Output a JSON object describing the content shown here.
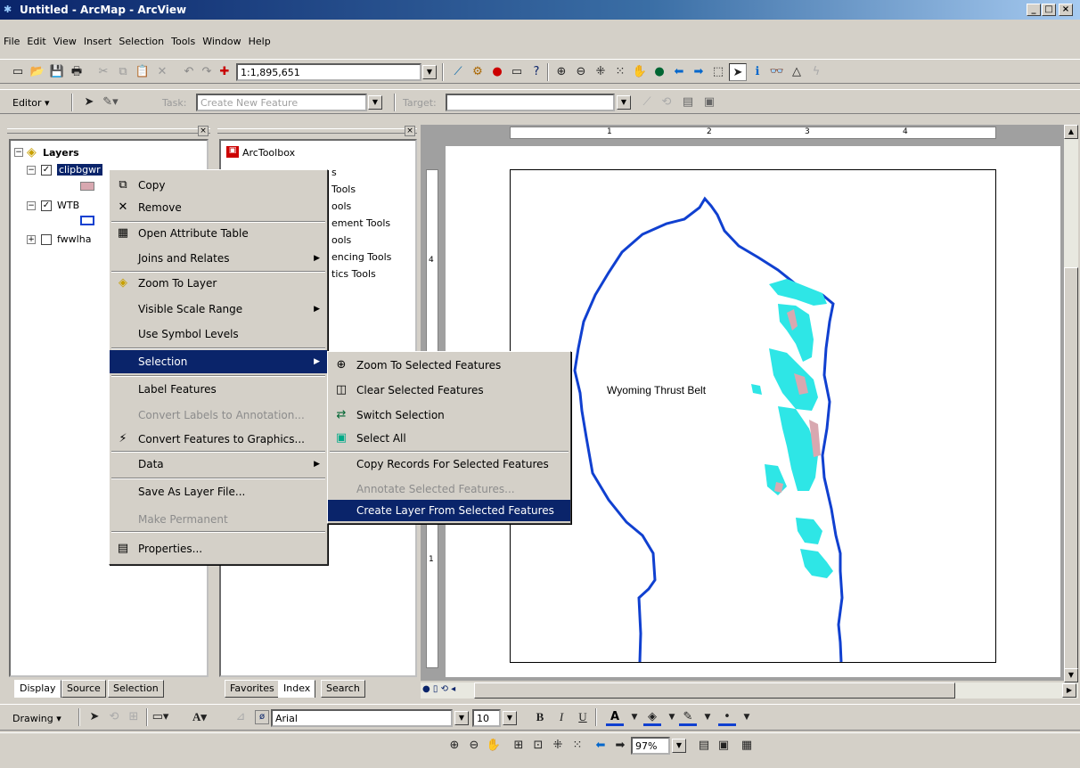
{
  "window": {
    "title": "Untitled - ArcMap - ArcView",
    "controls": [
      "_",
      "□",
      "×"
    ]
  },
  "menubar": {
    "items": [
      "File",
      "Edit",
      "View",
      "Insert",
      "Selection",
      "Tools",
      "Window",
      "Help"
    ]
  },
  "standard_toolbar": {
    "scale_value": "1:1,895,651"
  },
  "editor_toolbar": {
    "editor_label": "Editor ▾",
    "task_label": "Task:",
    "task_value": "Create New Feature",
    "target_label": "Target:",
    "target_value": ""
  },
  "toc": {
    "root_label": "Layers",
    "layers": [
      {
        "name": "clipbgwr",
        "checked": true,
        "expanded": true
      },
      {
        "name": "WTB",
        "checked": true,
        "expanded": true
      },
      {
        "name": "fwwlha",
        "checked": false,
        "expanded": false
      }
    ],
    "tabs": [
      "Display",
      "Source",
      "Selection"
    ]
  },
  "toolbox": {
    "root_label": "ArcToolbox",
    "items": [
      "Analysis Tools",
      "Cartography Tools",
      "Conversion Tools",
      "Data Management Tools",
      "Geocoding Tools",
      "Linear Referencing Tools",
      "Spatial Statistics Tools"
    ],
    "visible_fragments": [
      "s",
      "Tools",
      "ools",
      "ement Tools",
      "ools",
      "encing Tools",
      "tics Tools"
    ],
    "tabs": [
      "Favorites",
      "Index",
      "Search"
    ]
  },
  "context_menu": {
    "items": [
      {
        "label": "Copy",
        "icon": "copy-icon"
      },
      {
        "label": "Remove",
        "icon": "remove-icon"
      },
      {
        "label": "Open Attribute Table",
        "icon": "table-icon"
      },
      {
        "label": "Joins and Relates",
        "submenu": true
      },
      {
        "label": "Zoom To Layer",
        "icon": "zoom-layer-icon"
      },
      {
        "label": "Visible Scale Range",
        "submenu": true
      },
      {
        "label": "Use Symbol Levels"
      },
      {
        "label": "Selection",
        "submenu": true,
        "highlighted": true
      },
      {
        "label": "Label Features"
      },
      {
        "label": "Convert Labels to Annotation...",
        "disabled": true
      },
      {
        "label": "Convert Features to Graphics...",
        "icon": "convert-graphics-icon"
      },
      {
        "label": "Data",
        "submenu": true
      },
      {
        "label": "Save As Layer File..."
      },
      {
        "label": "Make Permanent",
        "disabled": true
      },
      {
        "label": "Properties...",
        "icon": "properties-icon"
      }
    ]
  },
  "selection_submenu": {
    "items": [
      {
        "label": "Zoom To Selected Features",
        "icon": "zoom-selected-icon"
      },
      {
        "label": "Clear Selected Features",
        "icon": "clear-selection-icon"
      },
      {
        "label": "Switch Selection",
        "icon": "switch-selection-icon"
      },
      {
        "label": "Select All",
        "icon": "select-all-icon"
      },
      {
        "label": "Copy Records For Selected Features"
      },
      {
        "label": "Annotate Selected Features...",
        "disabled": true
      },
      {
        "label": "Create Layer From Selected Features",
        "highlighted": true
      }
    ]
  },
  "map": {
    "label": "Wyoming Thrust Belt",
    "ruler_ticks": [
      "1",
      "2",
      "3",
      "4"
    ],
    "vruler_ticks": [
      "4",
      "1"
    ],
    "colors": {
      "boundary": "#1040d0",
      "cyan": "#2ee6e6",
      "pink": "#d8a8b0"
    }
  },
  "drawing_toolbar": {
    "drawing_label": "Drawing ▾",
    "font": "Arial",
    "size": "10",
    "bold": "B",
    "italic": "I",
    "underline": "U"
  },
  "layout_toolbar": {
    "zoom": "97%"
  }
}
